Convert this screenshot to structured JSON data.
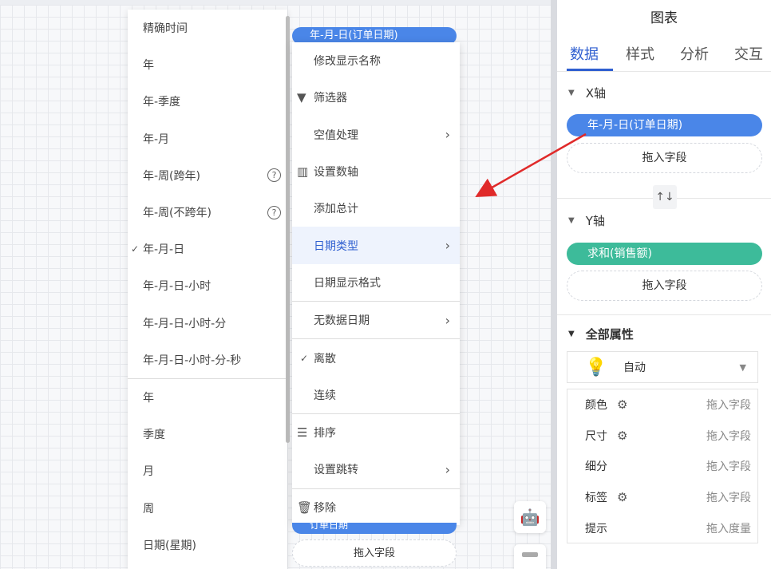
{
  "date_type_submenu": {
    "items": [
      {
        "label": "精确时间",
        "checked": false,
        "help": false
      },
      {
        "label": "年",
        "checked": false,
        "help": false
      },
      {
        "label": "年-季度",
        "checked": false,
        "help": false
      },
      {
        "label": "年-月",
        "checked": false,
        "help": false
      },
      {
        "label": "年-周(跨年)",
        "checked": false,
        "help": true
      },
      {
        "label": "年-周(不跨年)",
        "checked": false,
        "help": true
      },
      {
        "label": "年-月-日",
        "checked": true,
        "help": false
      },
      {
        "label": "年-月-日-小时",
        "checked": false,
        "help": false
      },
      {
        "label": "年-月-日-小时-分",
        "checked": false,
        "help": false
      },
      {
        "label": "年-月-日-小时-分-秒",
        "checked": false,
        "help": false
      }
    ],
    "items_part2": [
      {
        "label": "年"
      },
      {
        "label": "季度"
      },
      {
        "label": "月"
      },
      {
        "label": "周"
      },
      {
        "label": "日期(星期)"
      }
    ],
    "help_glyph": "?",
    "check_glyph": "✓"
  },
  "field_pill_top": "年-月-日(订单日期)",
  "field_pill_bottom": "订单日期",
  "field_drop_bottom": "拖入字段",
  "context_menu": {
    "items": [
      {
        "label": "修改显示名称",
        "icon": "",
        "chevron": false,
        "active": false
      },
      {
        "label": "筛选器",
        "icon": "filter-icon",
        "chevron": false,
        "active": false
      },
      {
        "label": "空值处理",
        "icon": "",
        "chevron": true,
        "active": false
      },
      {
        "label": "设置数轴",
        "icon": "axis-icon",
        "chevron": false,
        "active": false
      },
      {
        "label": "添加总计",
        "icon": "",
        "chevron": false,
        "active": false
      },
      {
        "label": "日期类型",
        "icon": "",
        "chevron": true,
        "active": true
      },
      {
        "label": "日期显示格式",
        "icon": "",
        "chevron": false,
        "active": false
      }
    ],
    "items_b": [
      {
        "label": "无数据日期",
        "chevron": true
      }
    ],
    "items_c": [
      {
        "label": "离散",
        "checked": true
      },
      {
        "label": "连续",
        "checked": false
      }
    ],
    "items_d": [
      {
        "label": "排序",
        "icon": "sort-icon",
        "chevron": false
      },
      {
        "label": "设置跳转",
        "icon": "",
        "chevron": true
      }
    ],
    "items_e": [
      {
        "label": "移除",
        "icon": "trash-icon"
      }
    ]
  },
  "panel": {
    "title": "图表",
    "tabs": [
      "数据",
      "样式",
      "分析",
      "交互"
    ],
    "active_tab": "数据",
    "x_axis": {
      "header": "X轴",
      "field": "年-月-日(订单日期)",
      "drop": "拖入字段",
      "pill_color": "#4a86e8"
    },
    "swap_glyph": "↑↓",
    "y_axis": {
      "header": "Y轴",
      "field": "求和(销售额)",
      "drop": "拖入字段",
      "pill_color": "#3dbb9a"
    },
    "all_props": {
      "header": "全部属性",
      "chart_type": "自动",
      "rows": [
        {
          "name": "颜色",
          "gear": true,
          "drop": "拖入字段"
        },
        {
          "name": "尺寸",
          "gear": true,
          "drop": "拖入字段"
        },
        {
          "name": "细分",
          "gear": false,
          "drop": "拖入字段"
        },
        {
          "name": "标签",
          "gear": true,
          "drop": "拖入字段"
        },
        {
          "name": "提示",
          "gear": false,
          "drop": "拖入度量"
        }
      ]
    }
  },
  "colors": {
    "accent": "#2f5fd0",
    "pill_blue": "#4a86e8",
    "pill_green": "#3dbb9a",
    "arrow": "#e02a2a"
  }
}
